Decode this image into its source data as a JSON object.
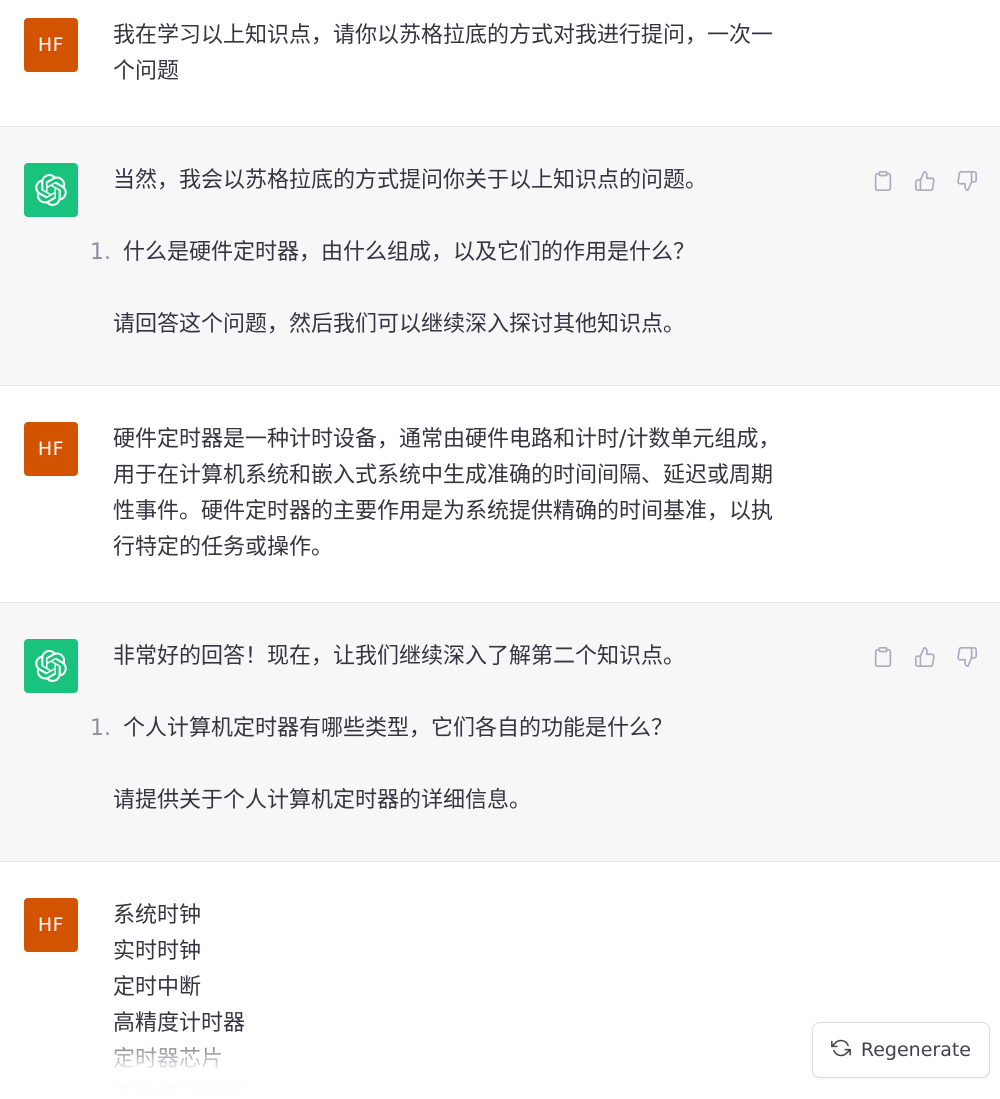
{
  "messages": [
    {
      "role": "user",
      "avatar": "HF",
      "text": "我在学习以上知识点，请你以苏格拉底的方式对我进行提问，一次一\n个问题"
    },
    {
      "role": "assistant",
      "intro": "当然，我会以苏格拉底的方式提问你关于以上知识点的问题。",
      "list_number": "1.",
      "list_text": "什么是硬件定时器，由什么组成，以及它们的作用是什么？",
      "outro": "请回答这个问题，然后我们可以继续深入探讨其他知识点。"
    },
    {
      "role": "user",
      "avatar": "HF",
      "text": "硬件定时器是一种计时设备，通常由硬件电路和计时/计数单元组成，\n用于在计算机系统和嵌入式系统中生成准确的时间间隔、延迟或周期\n性事件。硬件定时器的主要作用是为系统提供精确的时间基准，以执\n行特定的任务或操作。"
    },
    {
      "role": "assistant",
      "intro": "非常好的回答！现在，让我们继续深入了解第二个知识点。",
      "list_number": "1.",
      "list_text": "个人计算机定时器有哪些类型，它们各自的功能是什么？",
      "outro": "请提供关于个人计算机定时器的详细信息。"
    },
    {
      "role": "user",
      "avatar": "HF",
      "text": "系统时钟\n实时时钟\n定时中断\n高精度计时器\n定时器芯片\n高性能计时器"
    }
  ],
  "icons": {
    "copy": "clipboard-icon",
    "like": "thumbs-up-icon",
    "dislike": "thumbs-down-icon",
    "regenerate": "refresh-icon",
    "assistant_avatar": "openai-logo-icon"
  },
  "regenerate_label": "Regenerate",
  "colors": {
    "user_avatar": "#d35400",
    "assistant_avatar": "#19c37d",
    "assistant_bg": "#f7f7f8"
  }
}
